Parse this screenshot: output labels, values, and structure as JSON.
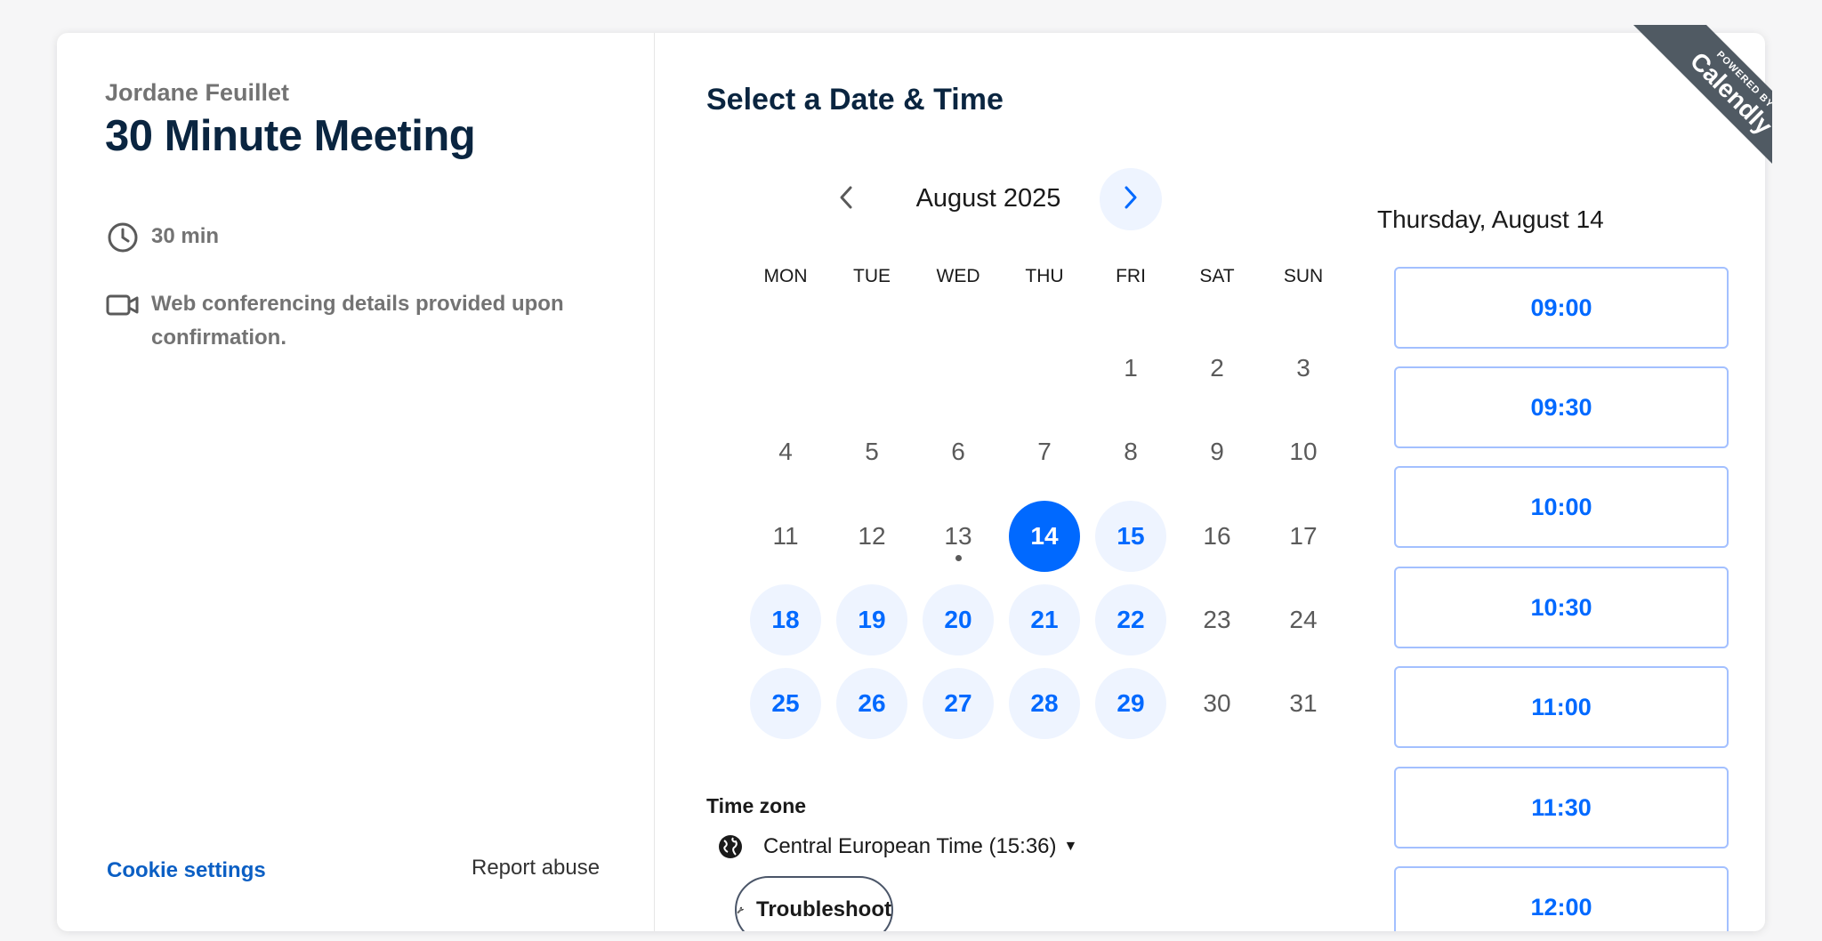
{
  "host": {
    "name": "Jordane Feuillet"
  },
  "event": {
    "title": "30 Minute Meeting",
    "duration": "30 min",
    "conferencing": "Web conferencing details provided upon confirmation."
  },
  "footer": {
    "cookie_settings": "Cookie settings",
    "report_abuse": "Report abuse"
  },
  "scheduler": {
    "title": "Select a Date & Time",
    "month": "August 2025",
    "weekdays": [
      "MON",
      "TUE",
      "WED",
      "THU",
      "FRI",
      "SAT",
      "SUN"
    ],
    "selected_day": "14",
    "available_days": [
      "15",
      "18",
      "19",
      "20",
      "21",
      "22",
      "25",
      "26",
      "27",
      "28",
      "29"
    ],
    "today": "13"
  },
  "timezone": {
    "label": "Time zone",
    "value": "Central European Time (15:36)"
  },
  "troubleshoot": {
    "label": "Troubleshoot"
  },
  "slots": {
    "date_label": "Thursday, August 14",
    "times": [
      "09:00",
      "09:30",
      "10:00",
      "10:30",
      "11:00",
      "11:30",
      "12:00"
    ]
  },
  "ribbon": {
    "small": "POWERED BY",
    "brand": "Calendly"
  },
  "colors": {
    "accent": "#0069ff",
    "available_bg": "#eef4ff",
    "title": "#0a2540"
  },
  "icons": [
    "clock-icon",
    "video-icon",
    "chevron-left-icon",
    "chevron-right-icon",
    "globe-icon",
    "wrench-icon"
  ]
}
